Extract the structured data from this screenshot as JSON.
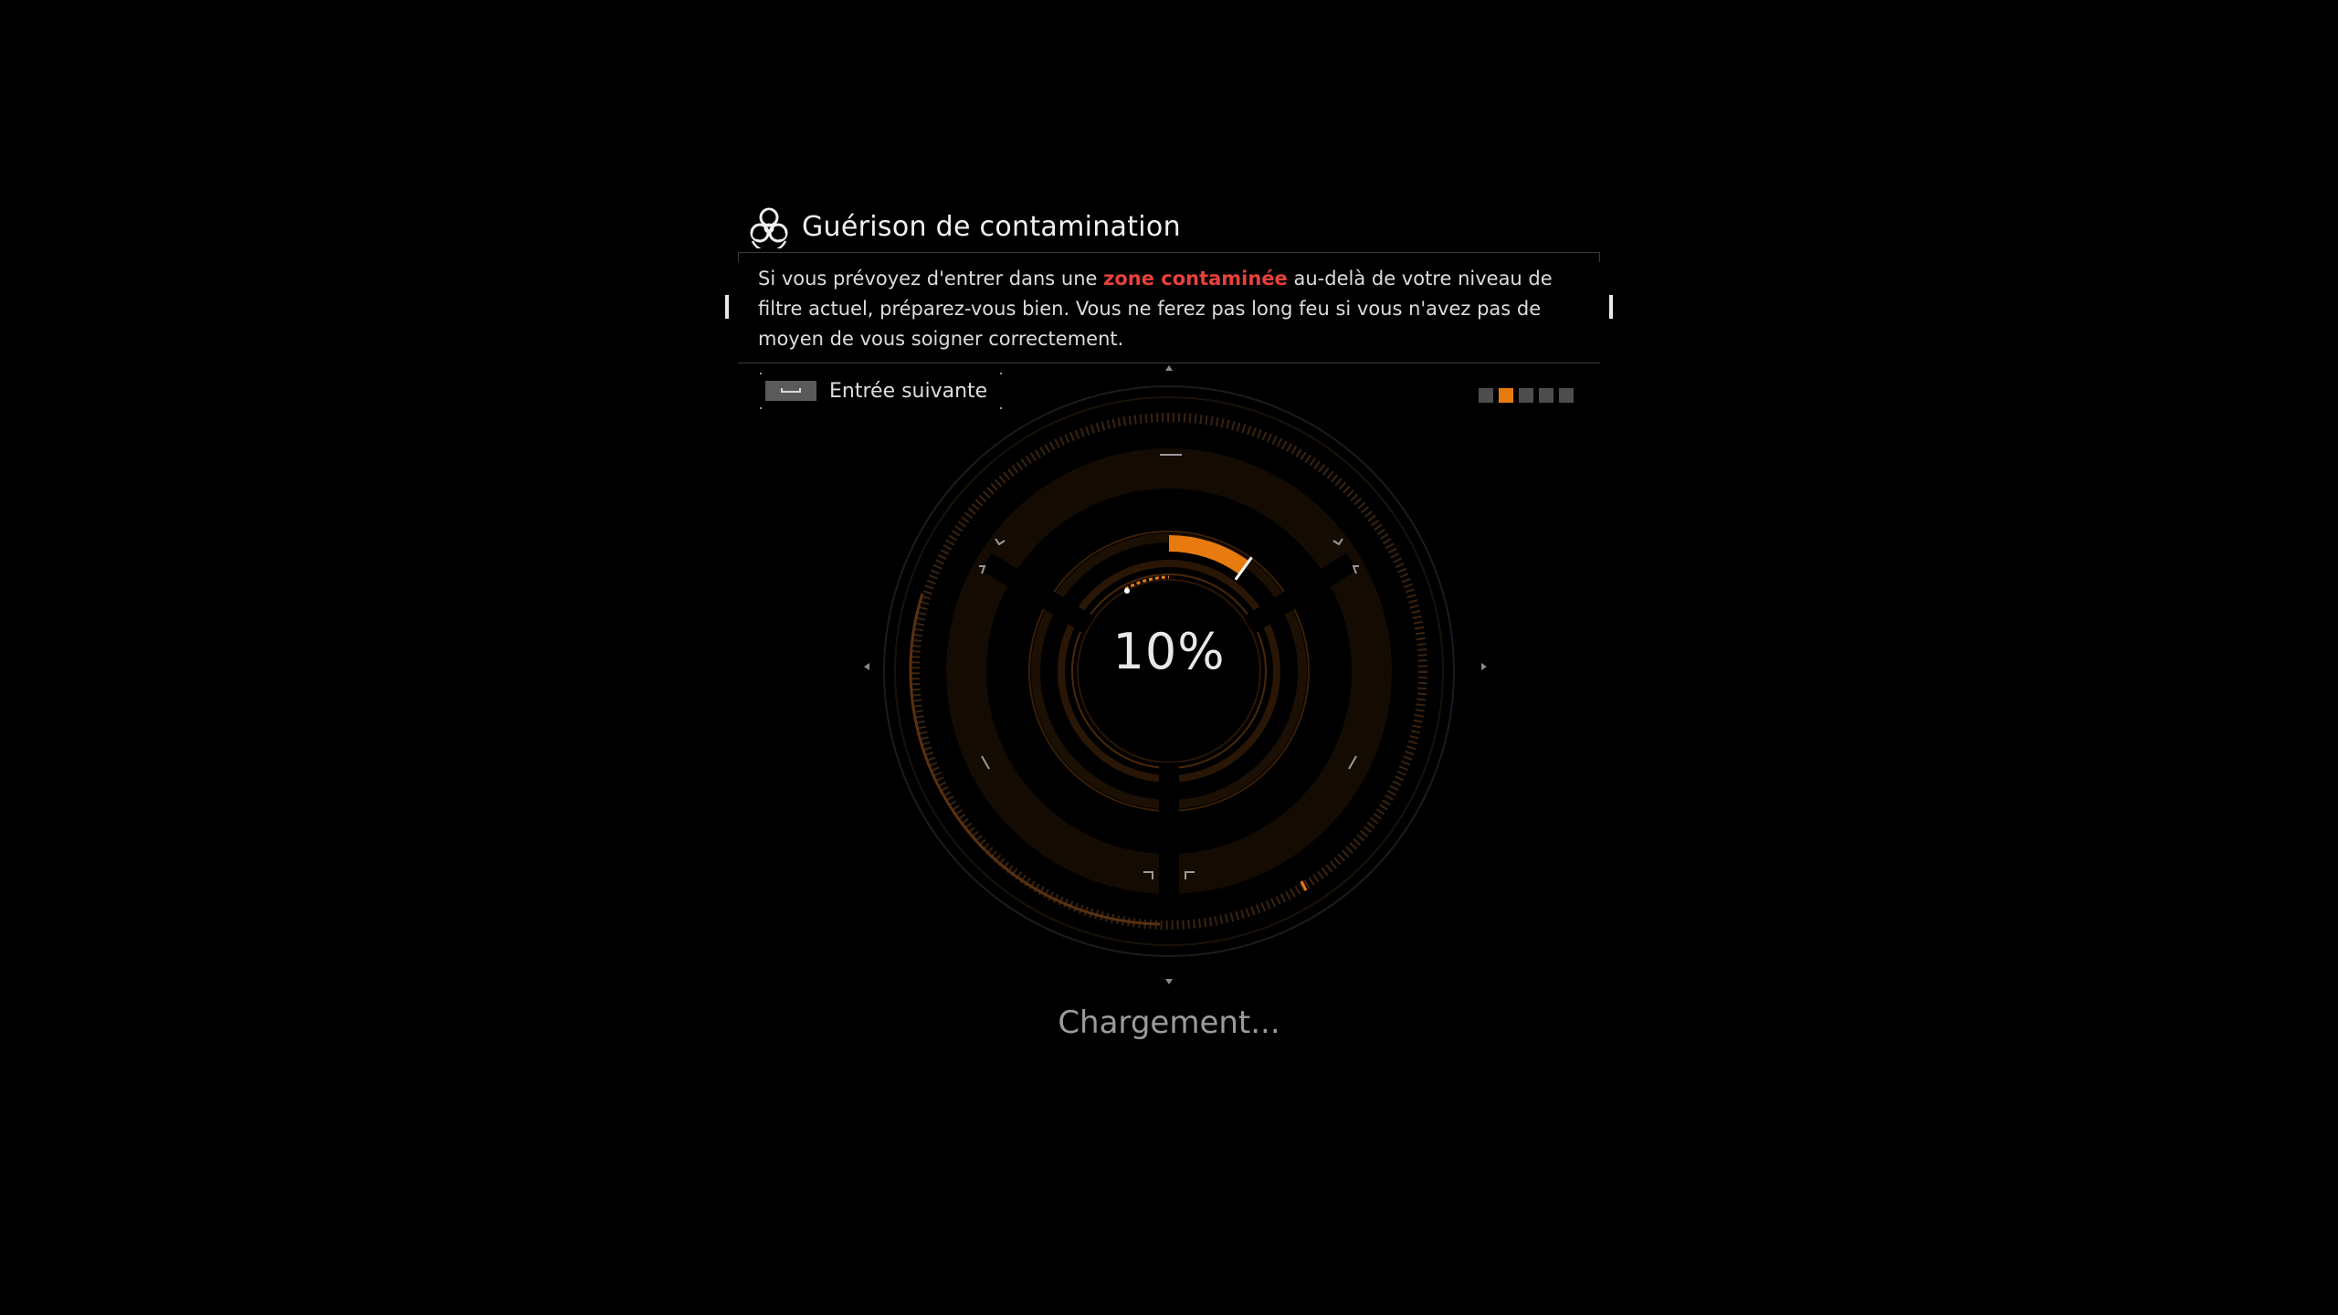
{
  "tip": {
    "icon": "biohazard-icon",
    "title": "Guérison de contamination",
    "text_before": "Si vous prévoyez d'entrer dans une ",
    "highlight": "zone contaminée",
    "text_after": " au-delà de votre niveau de filtre actuel, préparez-vous bien. Vous ne ferez pas long feu si vous n'avez pas de moyen de vous soigner correctement.",
    "highlight_color": "#e8413a"
  },
  "next_entry": {
    "key_icon": "spacebar-key-icon",
    "label": "Entrée suivante"
  },
  "pagination": {
    "total": 5,
    "current": 2,
    "active_color": "#e87b10",
    "inactive_color": "#4d4d4d"
  },
  "loader": {
    "percent_label": "10%",
    "progress": 0.1,
    "accent_color": "#e87b10",
    "status_label": "Chargement..."
  }
}
